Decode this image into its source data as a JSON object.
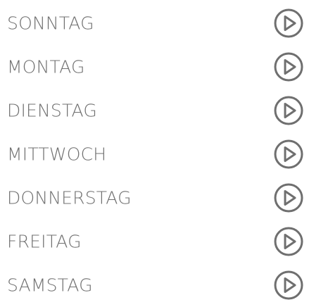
{
  "days": [
    {
      "label": "SONNTAG",
      "icon": "play-circle-icon"
    },
    {
      "label": "MONTAG",
      "icon": "play-circle-icon"
    },
    {
      "label": "DIENSTAG",
      "icon": "play-circle-icon"
    },
    {
      "label": "MITTWOCH",
      "icon": "play-circle-icon"
    },
    {
      "label": "DONNERSTAG",
      "icon": "play-circle-icon"
    },
    {
      "label": "FREITAG",
      "icon": "play-circle-icon"
    },
    {
      "label": "SAMSTAG",
      "icon": "play-circle-icon"
    }
  ],
  "colors": {
    "text": "#707070",
    "icon": "#6f6f6f",
    "background": "#ffffff"
  }
}
